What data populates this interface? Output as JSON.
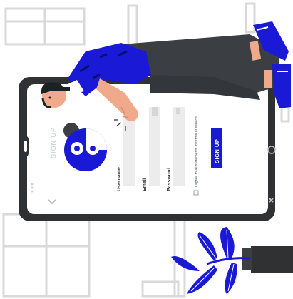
{
  "form": {
    "title": "SIGN UP",
    "fields": [
      {
        "label": "Username"
      },
      {
        "label": "Email"
      },
      {
        "label": "Password"
      }
    ],
    "terms_text": "I agree to all statements in terms of service",
    "submit_label": "SIGN UP"
  },
  "colors": {
    "accent": "#1a1ad6",
    "phone_body": "#2f3133",
    "screen": "#ffffff",
    "pants": "#3b3f43",
    "skin": "#f0a98a",
    "window_lines": "#d8d8d8"
  }
}
